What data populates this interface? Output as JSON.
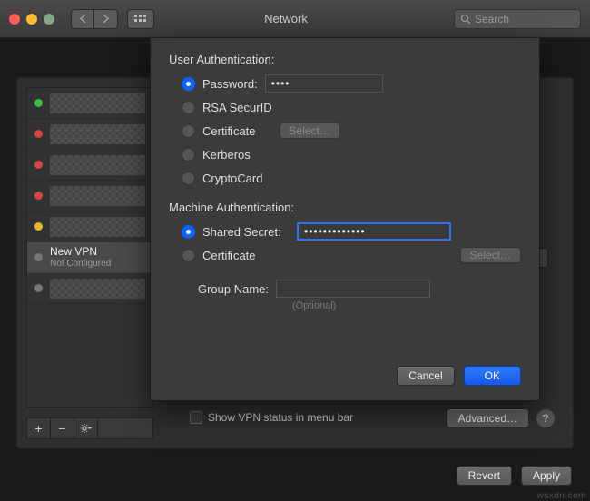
{
  "window": {
    "title": "Network"
  },
  "toolbar": {
    "search_placeholder": "Search"
  },
  "sidebar": {
    "items": [
      {
        "status": "g"
      },
      {
        "status": "r"
      },
      {
        "status": "r"
      },
      {
        "status": "r"
      },
      {
        "status": "y"
      }
    ],
    "vpn": {
      "name": "New VPN",
      "sub": "Not Configured",
      "status": "gray"
    },
    "trailing": {
      "status": "gray"
    }
  },
  "main": {
    "show_vpn_label": "Show VPN status in menu bar",
    "advanced_label": "Advanced…"
  },
  "bottom": {
    "revert": "Revert",
    "apply": "Apply"
  },
  "sheet": {
    "user_auth": {
      "heading": "User Authentication:",
      "options": {
        "password": "Password:",
        "rsa": "RSA SecurID",
        "cert": "Certificate",
        "kerberos": "Kerberos",
        "crypto": "CryptoCard"
      },
      "password_value": "••••",
      "select_label": "Select…"
    },
    "machine_auth": {
      "heading": "Machine Authentication:",
      "options": {
        "shared": "Shared Secret:",
        "cert": "Certificate"
      },
      "shared_value": "•••••••••••••",
      "select_label": "Select…"
    },
    "group": {
      "label": "Group Name:",
      "value": "",
      "placeholder": "(Optional)"
    },
    "buttons": {
      "cancel": "Cancel",
      "ok": "OK"
    }
  },
  "watermark": "wsxdn.com"
}
